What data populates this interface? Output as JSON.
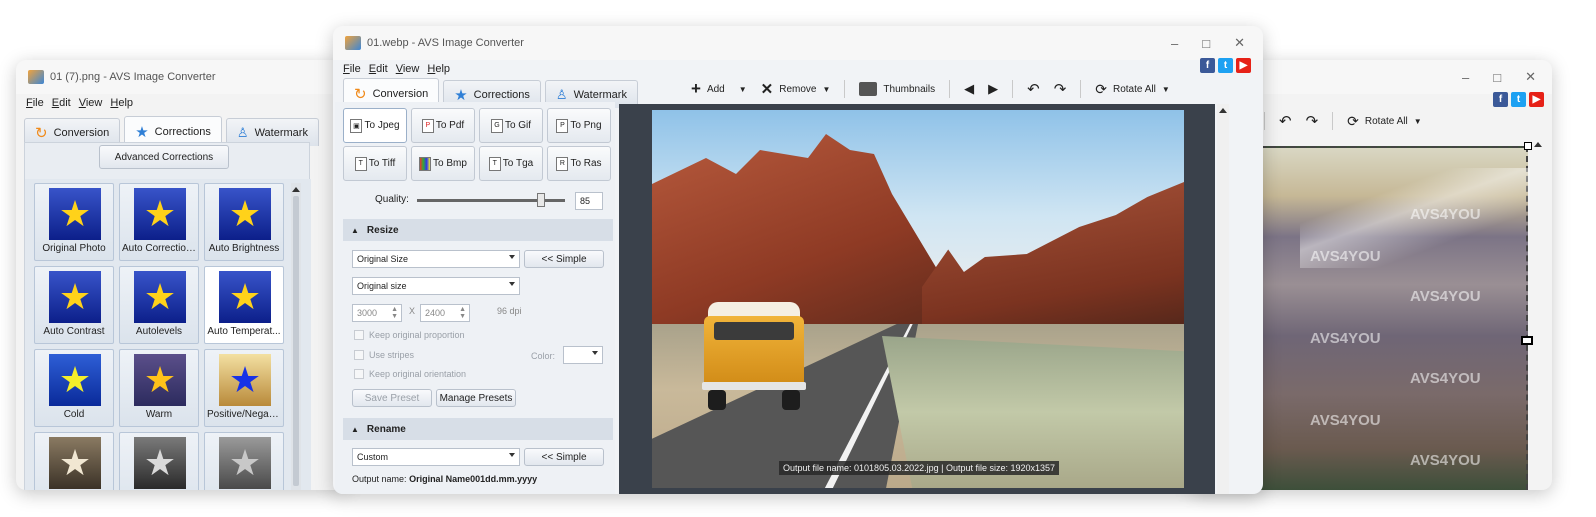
{
  "left_window": {
    "title": "01 (7).png - AVS Image Converter",
    "menu": [
      "File",
      "Edit",
      "View",
      "Help"
    ],
    "tabs": [
      {
        "label": "Conversion",
        "icon": "refresh-icon"
      },
      {
        "label": "Corrections",
        "icon": "star-icon"
      },
      {
        "label": "Watermark",
        "icon": "stamp-icon"
      }
    ],
    "advanced_button": "Advanced Corrections",
    "effects": [
      {
        "label": "Original Photo",
        "star": "yellow"
      },
      {
        "label": "Auto Corrections",
        "star": "yellow"
      },
      {
        "label": "Auto Brightness",
        "star": "yellow"
      },
      {
        "label": "Auto Contrast",
        "star": "yellow"
      },
      {
        "label": "Autolevels",
        "star": "yellow"
      },
      {
        "label": "Auto Temperat...",
        "star": "yellow"
      },
      {
        "label": "Cold",
        "star": "yellow"
      },
      {
        "label": "Warm",
        "star": "yellow"
      },
      {
        "label": "Positive/Negative",
        "star": "blue"
      },
      {
        "label": "",
        "star": "beige"
      },
      {
        "label": "",
        "star": "gray"
      },
      {
        "label": "",
        "star": "gray"
      }
    ]
  },
  "main_window": {
    "title": "01.webp - AVS Image Converter",
    "menu": [
      "File",
      "Edit",
      "View",
      "Help"
    ],
    "tabs": [
      {
        "label": "Conversion",
        "icon": "refresh-icon"
      },
      {
        "label": "Corrections",
        "icon": "star-icon"
      },
      {
        "label": "Watermark",
        "icon": "stamp-icon"
      }
    ],
    "formats": [
      {
        "label": "To Jpeg",
        "icon": "camera-icon"
      },
      {
        "label": "To Pdf",
        "icon": "pdf-icon"
      },
      {
        "label": "To Gif",
        "icon": "gif-icon"
      },
      {
        "label": "To Png",
        "icon": "png-icon"
      },
      {
        "label": "To Tiff",
        "icon": "tiff-icon"
      },
      {
        "label": "To Bmp",
        "icon": "bmp-icon"
      },
      {
        "label": "To Tga",
        "icon": "tga-icon"
      },
      {
        "label": "To Ras",
        "icon": "ras-icon"
      }
    ],
    "quality": {
      "label": "Quality:",
      "value": "85",
      "level": 0.85
    },
    "resize": {
      "header": "Resize",
      "size_select": "Original Size",
      "simple_button": "<< Simple",
      "size_select2": "Original size",
      "width": "3000",
      "x_label": "X",
      "height": "2400",
      "dpi": "96 dpi",
      "keep_proportion": "Keep original proportion",
      "use_stripes": "Use stripes",
      "color_label": "Color:",
      "keep_orientation": "Keep original orientation",
      "save_preset": "Save Preset",
      "manage_presets": "Manage Presets"
    },
    "rename": {
      "header": "Rename",
      "select": "Custom",
      "simple_button": "<< Simple",
      "output_label": "Output name:",
      "output_value": "Original Name001dd.mm.yyyy"
    },
    "toolbar": {
      "add": "Add",
      "remove": "Remove",
      "thumbnails": "Thumbnails",
      "rotate_all": "Rotate All"
    },
    "status": "Output file name: 0101805.03.2022.jpg | Output file size: 1920x1357"
  },
  "right_window": {
    "rotate_all": "Rotate All",
    "watermark_text": "AVS4YOU"
  },
  "colors": {
    "facebook": "#3b5998",
    "twitter": "#1da1f2",
    "youtube": "#e62117",
    "preview_bg": "#3a414b"
  }
}
